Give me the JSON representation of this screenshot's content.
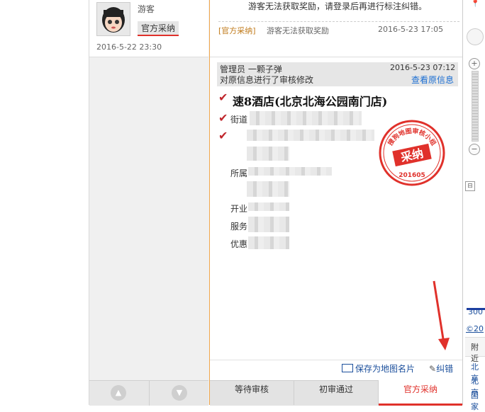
{
  "left": {
    "username": "游客",
    "tag": "官方采纳",
    "time": "2016-5-22 23:30",
    "up_icon": "▲",
    "down_icon": "▼"
  },
  "top": {
    "message": "游客无法获取奖励，请登录后再进行标注纠错。",
    "reply_tag": "[官方采纳]",
    "reply_text": "游客无法获取奖励",
    "reply_time": "2016-5-23 17:05"
  },
  "review": {
    "admin": "管理员 一颗子弹",
    "time": "2016-5-23 07:12",
    "desc": "对原信息进行了审核修改",
    "view_original": "查看原信息",
    "poi_title": "速8酒店(北京北海公园南门店)",
    "labels": {
      "street": "街道",
      "belong": "所属",
      "open": "开业",
      "service": "服务",
      "discount": "优惠"
    }
  },
  "stamp": {
    "ring_text": "搜狗地图审核小组",
    "center_text": "采纳",
    "year_text": "201605"
  },
  "tools": {
    "save_card": "保存为地图名片",
    "correct": "纠错"
  },
  "tabs": [
    {
      "label": "等待审核"
    },
    {
      "label": "初审通过"
    },
    {
      "label": "官方采纳"
    }
  ],
  "map": {
    "zoom_in": "+",
    "zoom_out": "−",
    "scale": "300",
    "copyright": "©20",
    "nearby": "附近",
    "item1": "北京",
    "item2": "北京",
    "item3": "国家"
  },
  "colors": {
    "accent_red": "#e0312b",
    "link_blue": "#1b6ed2",
    "orange": "#f0a64c"
  }
}
